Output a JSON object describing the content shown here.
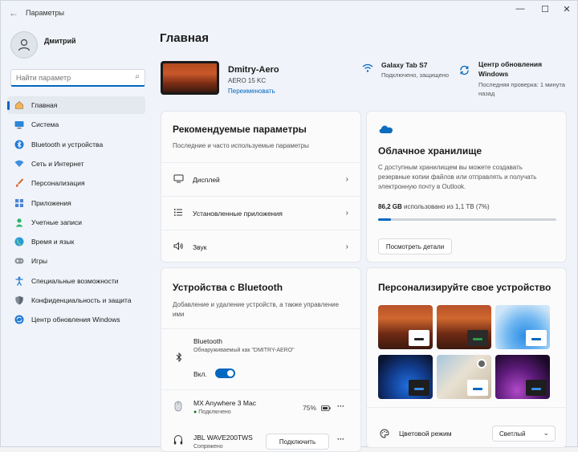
{
  "window": {
    "title": "Параметры",
    "back": "←",
    "minimize": "—",
    "maximize": "☐",
    "close": "✕"
  },
  "user": {
    "name": "Дмитрий"
  },
  "search": {
    "placeholder": "Найти параметр"
  },
  "nav": [
    {
      "label": "Главная",
      "icon": "home-icon",
      "active": true
    },
    {
      "label": "Система",
      "icon": "display-icon"
    },
    {
      "label": "Bluetooth и устройства",
      "icon": "bluetooth-icon"
    },
    {
      "label": "Сеть и Интернет",
      "icon": "wifi-icon"
    },
    {
      "label": "Персонализация",
      "icon": "brush-icon"
    },
    {
      "label": "Приложения",
      "icon": "apps-icon"
    },
    {
      "label": "Учетные записи",
      "icon": "person-icon"
    },
    {
      "label": "Время и язык",
      "icon": "globe-icon"
    },
    {
      "label": "Игры",
      "icon": "gamepad-icon"
    },
    {
      "label": "Специальные возможности",
      "icon": "accessibility-icon"
    },
    {
      "label": "Конфиденциальность и защита",
      "icon": "shield-icon"
    },
    {
      "label": "Центр обновления Windows",
      "icon": "update-icon"
    }
  ],
  "page": {
    "title": "Главная"
  },
  "device": {
    "name": "Dmitry-Aero",
    "model": "AERO 15 KC",
    "rename": "Переименовать"
  },
  "header_status": {
    "network": {
      "title": "Galaxy Tab S7",
      "subtitle": "Подключено, защищено"
    },
    "update": {
      "title_line1": "Центр обновления",
      "title_line2": "Windows",
      "subtitle_line1": "Последняя проверка: 1 минута",
      "subtitle_line2": "назад"
    }
  },
  "recommended": {
    "title": "Рекомендуемые параметры",
    "subtitle": "Последние и часто используемые параметры",
    "items": [
      {
        "label": "Дисплей",
        "icon": "monitor-icon"
      },
      {
        "label": "Установленные приложения",
        "icon": "list-icon"
      },
      {
        "label": "Звук",
        "icon": "speaker-icon"
      }
    ]
  },
  "cloud": {
    "title": "Облачное хранилище",
    "description": "С доступным хранилищем вы можете создавать резервные копии файлов или отправлять и получать электронную почту в Outlook.",
    "used": "86,2 GB",
    "usage_text": "использовано из 1,1 TB (7%)",
    "usage_fraction": 0.07,
    "details_button": "Посмотреть детали"
  },
  "bluetooth": {
    "title": "Устройства с Bluetooth",
    "subtitle": "Добавление и удаление устройств, а также управление ими",
    "bt_label": "Bluetooth",
    "bt_discoverable": "Обнаруживаемый как \"DMITRY-AERO\"",
    "toggle_label": "Вкл.",
    "devices": [
      {
        "name": "MX Anywhere 3 Mac",
        "status": "Подключено",
        "battery": "75%",
        "more": "···"
      },
      {
        "name": "JBL WAVE200TWS",
        "status": "Сопряжено",
        "button": "Подключить",
        "more": "···"
      }
    ]
  },
  "personalize": {
    "title": "Персонализируйте свое устройство",
    "color_mode_label": "Цветовой режим",
    "color_mode_value": "Светлый"
  },
  "colors": {
    "accent": "#0067c0"
  }
}
